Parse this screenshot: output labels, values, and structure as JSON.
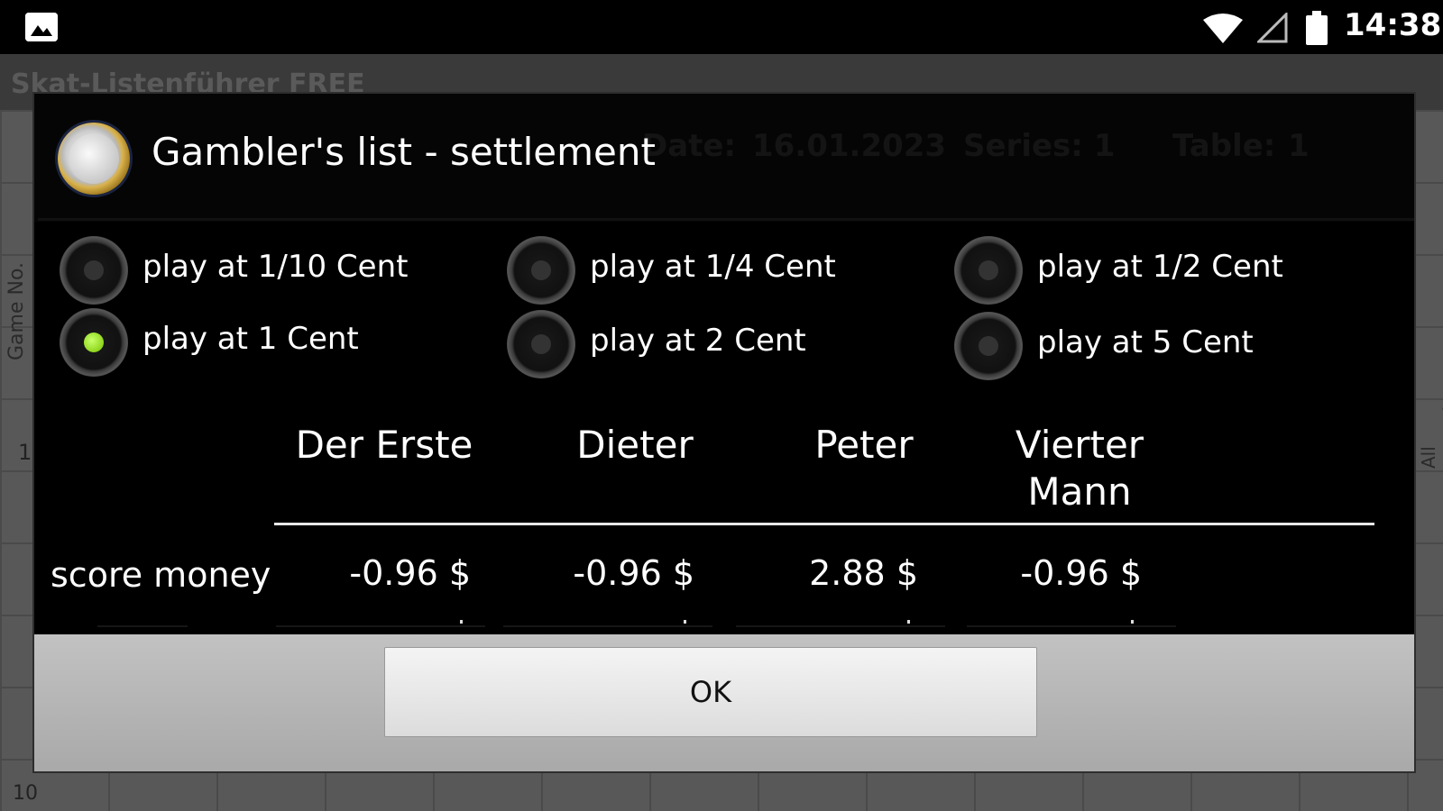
{
  "status_bar": {
    "time": "14:38",
    "icons": [
      "gallery-icon",
      "wifi-icon",
      "signal-icon",
      "battery-icon"
    ]
  },
  "background_app": {
    "title": "Skat-Listenführer FREE",
    "header": {
      "date_label": "Date:",
      "date_value": "16.01.2023",
      "series_label": "Series: 1",
      "table_label": "Table:",
      "table_value": "1"
    },
    "side_left": "Game No.",
    "side_right": "All Passed",
    "row_first": "1",
    "row_tenth": "10"
  },
  "dialog": {
    "title": "Gambler's list - settlement",
    "icon": "euro-coin-icon",
    "options": [
      {
        "label": "play at 1/10 Cent",
        "checked": false
      },
      {
        "label": "play at 1/4 Cent",
        "checked": false
      },
      {
        "label": "play at 1/2 Cent",
        "checked": false
      },
      {
        "label": "play at 1 Cent",
        "checked": true
      },
      {
        "label": "play at 2 Cent",
        "checked": false
      },
      {
        "label": "play at 5 Cent",
        "checked": false
      }
    ],
    "table": {
      "columns": [
        "Der Erste",
        "Dieter",
        "Peter",
        "Vierter Mann"
      ],
      "row_label": "score money",
      "values": [
        "-0.96 $",
        "-0.96 $",
        "2.88 $",
        "-0.96 $"
      ]
    },
    "ok_label": "OK",
    "accent_color": "#8fd61c"
  }
}
